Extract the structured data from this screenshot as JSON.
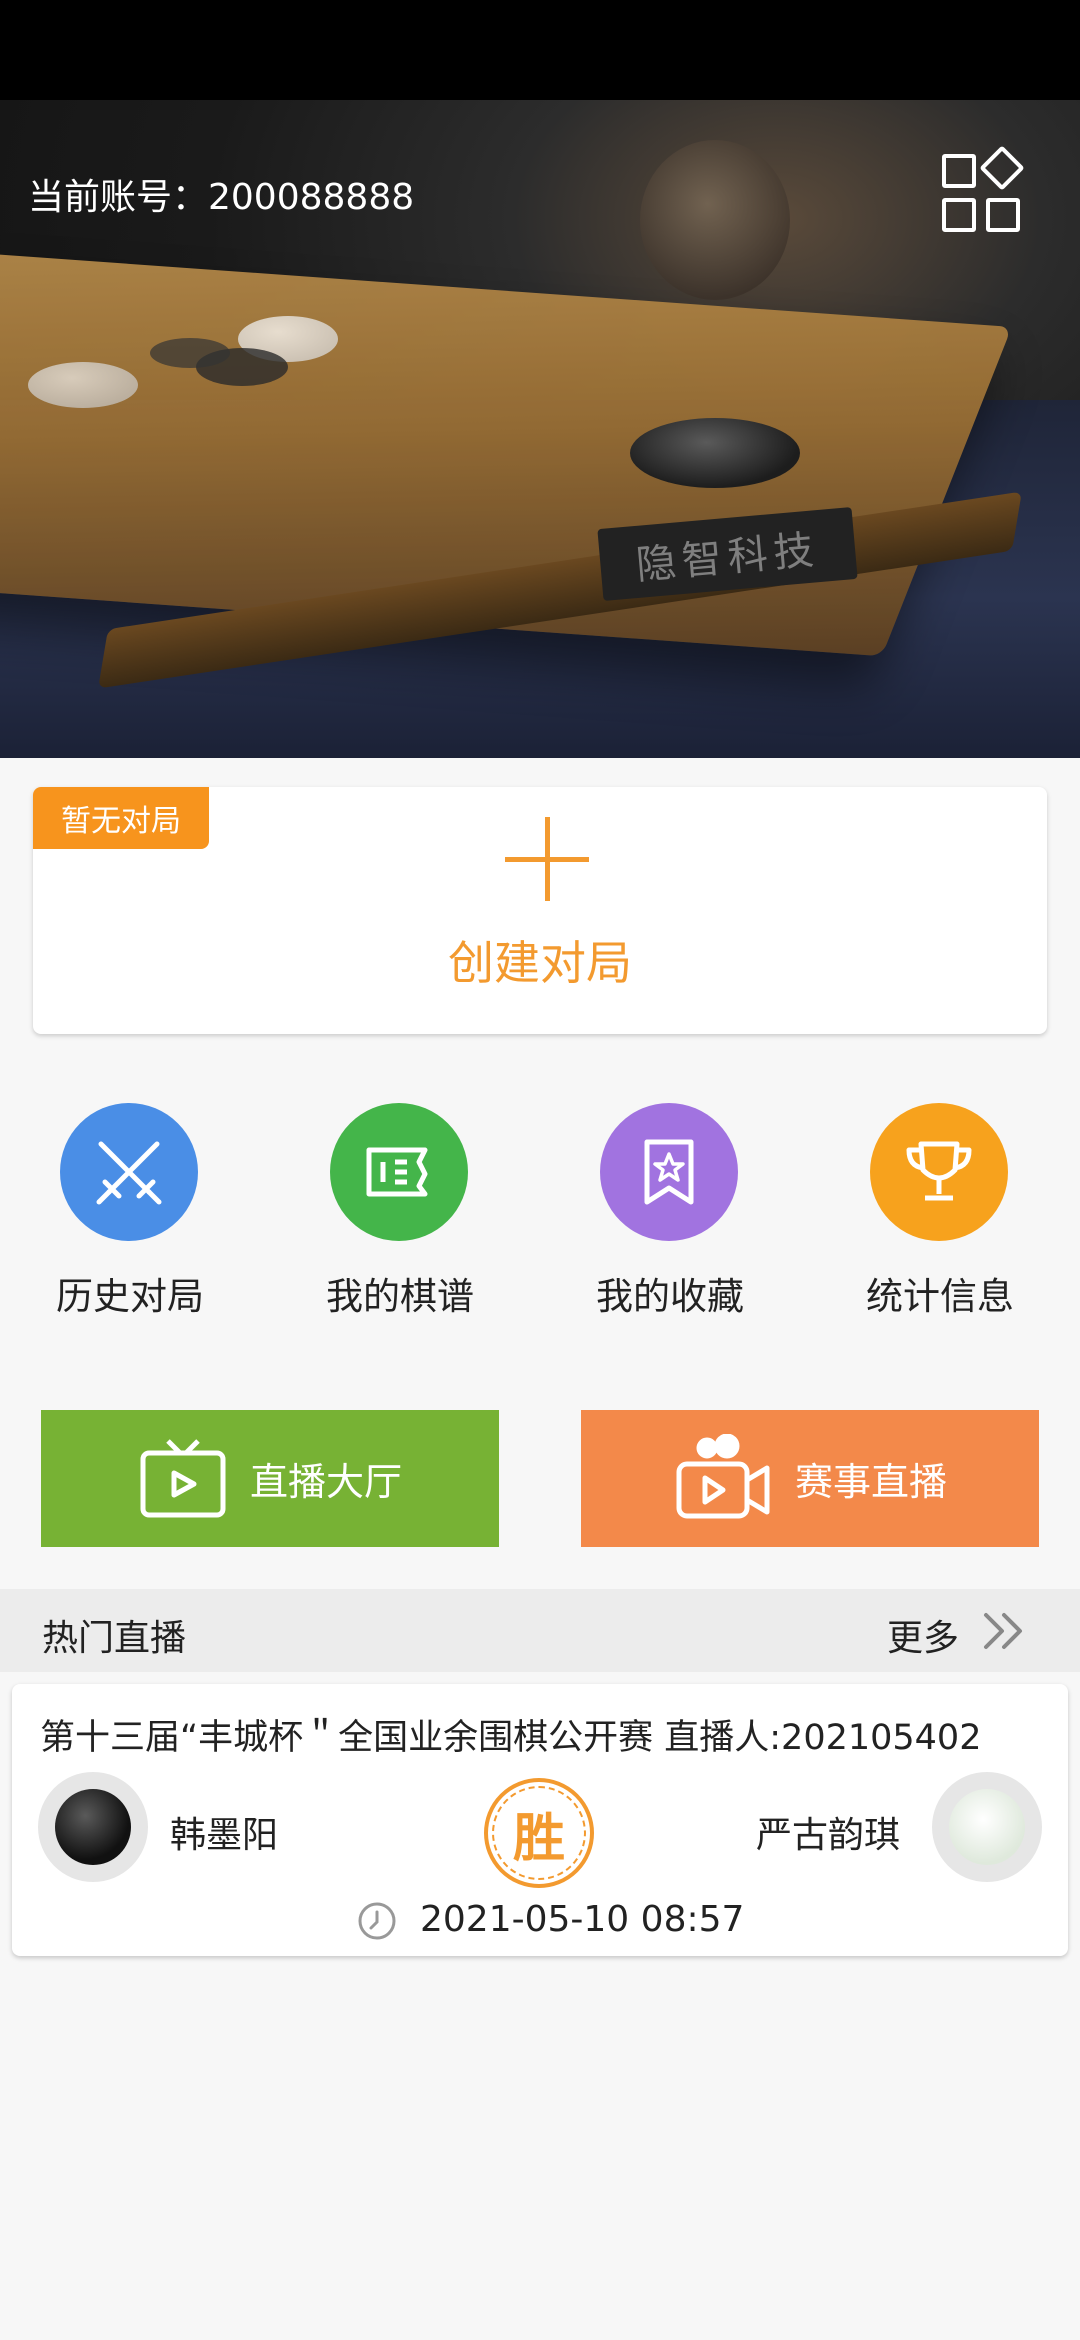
{
  "header": {
    "account_label": "当前账号：200088888",
    "plate_text": "隐智科技",
    "menu_icon": "apps-grid-icon"
  },
  "create_game": {
    "badge": "暂无对局",
    "label": "创建对局",
    "accent": "#f39a2f"
  },
  "quick_actions": [
    {
      "label": "历史对局",
      "icon": "crossed-swords-icon",
      "color": "#4a8ee6"
    },
    {
      "label": "我的棋谱",
      "icon": "scroll-icon",
      "color": "#44b54a"
    },
    {
      "label": "我的收藏",
      "icon": "bookmark-star-icon",
      "color": "#a173e0"
    },
    {
      "label": "统计信息",
      "icon": "trophy-icon",
      "color": "#f7a21d"
    }
  ],
  "live_buttons": [
    {
      "label": "直播大厅",
      "icon": "tv-icon",
      "color": "#77b234"
    },
    {
      "label": "赛事直播",
      "icon": "video-camera-icon",
      "color": "#f3894a"
    }
  ],
  "hot_live": {
    "title": "热门直播",
    "more": "更多",
    "game": {
      "title": "第十三届“丰城杯＂全国业余围棋公开赛  直播人:202105402",
      "black_player": "韩墨阳",
      "white_player": "严古韵琪",
      "result": "胜",
      "time": "2021-05-10 08:57"
    }
  }
}
